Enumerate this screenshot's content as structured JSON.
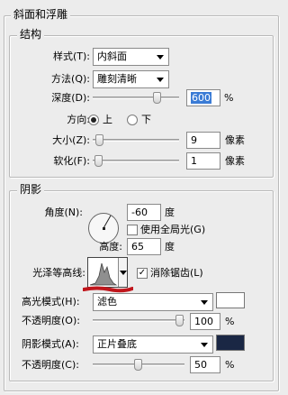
{
  "panel": {
    "title": "斜面和浮雕"
  },
  "structure": {
    "title": "结构",
    "style_label": "样式(T):",
    "style_value": "内斜面",
    "technique_label": "方法(Q):",
    "technique_value": "雕刻清晰",
    "depth_label": "深度(D):",
    "depth_value": "600",
    "depth_unit": "%",
    "depth_slider": 0.78,
    "direction_label": "方向:",
    "direction_up": "上",
    "direction_down": "下",
    "direction_selected": "上",
    "size_label": "大小(Z):",
    "size_value": "9",
    "size_unit": "像素",
    "size_slider": 0.04,
    "soften_label": "软化(F):",
    "soften_value": "1",
    "soften_unit": "像素",
    "soften_slider": 0.02
  },
  "shading": {
    "title": "阴影",
    "angle_label": "角度(N):",
    "angle_value": "-60",
    "angle_unit": "度",
    "global_light_label": "使用全局光(G)",
    "global_light_checked": false,
    "altitude_label": "高度:",
    "altitude_value": "65",
    "altitude_unit": "度",
    "gloss_contour_label": "光泽等高线:",
    "anti_aliased_label": "消除锯齿(L)",
    "anti_aliased_checked": true,
    "check_mark": "✓",
    "highlight_mode_label": "高光模式(H):",
    "highlight_mode_value": "滤色",
    "highlight_color": "#ffffff",
    "highlight_opacity_label": "不透明度(O):",
    "highlight_opacity_value": "100",
    "highlight_opacity_unit": "%",
    "highlight_opacity_slider": 1.0,
    "shadow_mode_label": "阴影模式(A):",
    "shadow_mode_value": "正片叠底",
    "shadow_color": "#1a2744",
    "shadow_opacity_label": "不透明度(C):",
    "shadow_opacity_value": "50",
    "shadow_opacity_unit": "%",
    "shadow_opacity_slider": 0.5
  }
}
